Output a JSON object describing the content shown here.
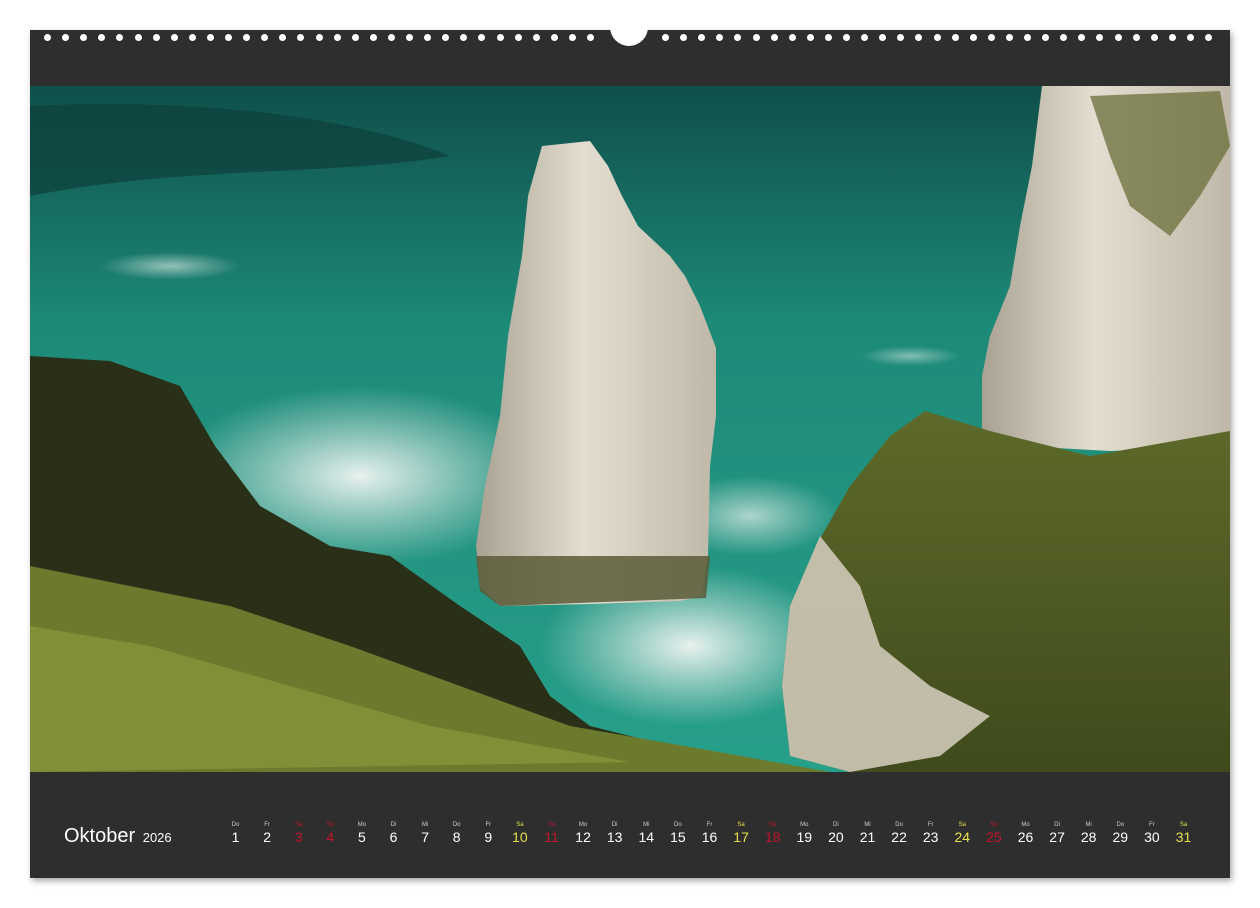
{
  "calendar": {
    "month": "Oktober",
    "year": "2026",
    "days": [
      {
        "wd": "Do",
        "num": "1",
        "kind": "week"
      },
      {
        "wd": "Fr",
        "num": "2",
        "kind": "week"
      },
      {
        "wd": "Sa",
        "num": "3",
        "kind": "sun"
      },
      {
        "wd": "So",
        "num": "4",
        "kind": "sun"
      },
      {
        "wd": "Mo",
        "num": "5",
        "kind": "week"
      },
      {
        "wd": "Di",
        "num": "6",
        "kind": "week"
      },
      {
        "wd": "Mi",
        "num": "7",
        "kind": "week"
      },
      {
        "wd": "Do",
        "num": "8",
        "kind": "week"
      },
      {
        "wd": "Fr",
        "num": "9",
        "kind": "week"
      },
      {
        "wd": "Sa",
        "num": "10",
        "kind": "sat"
      },
      {
        "wd": "So",
        "num": "11",
        "kind": "sun"
      },
      {
        "wd": "Mo",
        "num": "12",
        "kind": "week"
      },
      {
        "wd": "Di",
        "num": "13",
        "kind": "week"
      },
      {
        "wd": "Mi",
        "num": "14",
        "kind": "week"
      },
      {
        "wd": "Do",
        "num": "15",
        "kind": "week"
      },
      {
        "wd": "Fr",
        "num": "16",
        "kind": "week"
      },
      {
        "wd": "Sa",
        "num": "17",
        "kind": "sat"
      },
      {
        "wd": "So",
        "num": "18",
        "kind": "sun"
      },
      {
        "wd": "Mo",
        "num": "19",
        "kind": "week"
      },
      {
        "wd": "Di",
        "num": "20",
        "kind": "week"
      },
      {
        "wd": "Mi",
        "num": "21",
        "kind": "week"
      },
      {
        "wd": "Do",
        "num": "22",
        "kind": "week"
      },
      {
        "wd": "Fr",
        "num": "23",
        "kind": "week"
      },
      {
        "wd": "Sa",
        "num": "24",
        "kind": "sat"
      },
      {
        "wd": "So",
        "num": "25",
        "kind": "sun"
      },
      {
        "wd": "Mo",
        "num": "26",
        "kind": "week"
      },
      {
        "wd": "Di",
        "num": "27",
        "kind": "week"
      },
      {
        "wd": "Mi",
        "num": "28",
        "kind": "week"
      },
      {
        "wd": "Do",
        "num": "29",
        "kind": "week"
      },
      {
        "wd": "Fr",
        "num": "30",
        "kind": "week"
      },
      {
        "wd": "Sa",
        "num": "31",
        "kind": "sat"
      }
    ]
  },
  "photo": {
    "subject": "coastal-cliffs-sea-stack",
    "colors": {
      "sea": "#1d8a78",
      "sea_dark": "#0f4f4a",
      "surf": "#e4ecea",
      "chalk": "#d9d4c6",
      "chalk_shadow": "#a9a293",
      "grass": "#4f5a24",
      "grass_light": "#7c8a36",
      "rock_dark": "#2a3018"
    }
  },
  "colors": {
    "frame": "#2e2e2e",
    "saturday": "#e8e04a",
    "sunday": "#c0142a",
    "text": "#ffffff"
  }
}
